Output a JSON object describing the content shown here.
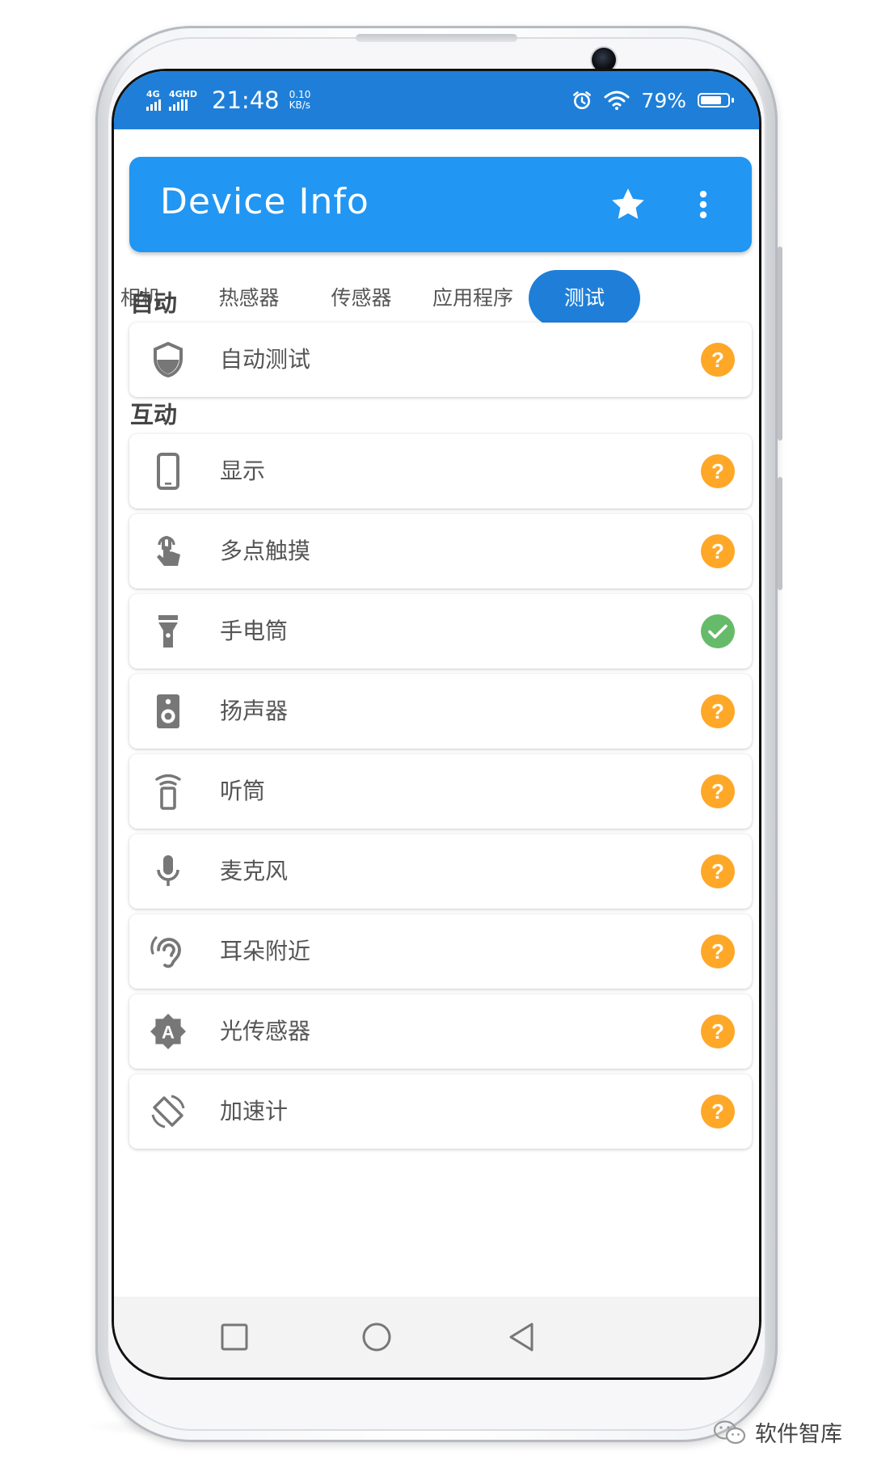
{
  "status_bar": {
    "sim1_label": "4G",
    "sim2_label": "4GHD",
    "time": "21:48",
    "speed_value": "0.10",
    "speed_unit": "KB/s",
    "battery_percent": "79%",
    "battery_level": 0.79,
    "icons": [
      "alarm-icon",
      "wifi-icon",
      "battery-icon"
    ]
  },
  "app_bar": {
    "title": "Device Info",
    "actions": [
      "star-icon",
      "more-vert-icon"
    ]
  },
  "tabs": [
    {
      "label": "相机",
      "active": false
    },
    {
      "label": "热感器",
      "active": false
    },
    {
      "label": "传感器",
      "active": false
    },
    {
      "label": "应用程序",
      "active": false
    },
    {
      "label": "测试",
      "active": true
    }
  ],
  "sections": [
    {
      "title": "自动",
      "items": [
        {
          "label": "自动测试",
          "icon": "shield-icon",
          "status": "unknown"
        }
      ]
    },
    {
      "title": "互动",
      "items": [
        {
          "label": "显示",
          "icon": "phone-icon",
          "status": "unknown"
        },
        {
          "label": "多点触摸",
          "icon": "touch-icon",
          "status": "unknown"
        },
        {
          "label": "手电筒",
          "icon": "flashlight-icon",
          "status": "passed"
        },
        {
          "label": "扬声器",
          "icon": "speaker-icon",
          "status": "unknown"
        },
        {
          "label": "听筒",
          "icon": "earpiece-icon",
          "status": "unknown"
        },
        {
          "label": "麦克风",
          "icon": "microphone-icon",
          "status": "unknown"
        },
        {
          "label": "耳朵附近",
          "icon": "hearing-icon",
          "status": "unknown"
        },
        {
          "label": "光传感器",
          "icon": "brightness-auto-icon",
          "status": "unknown"
        },
        {
          "label": "加速计",
          "icon": "screen-rotation-icon",
          "status": "unknown"
        }
      ]
    }
  ],
  "nav_bar": [
    "recents-square-icon",
    "home-circle-icon",
    "back-triangle-icon"
  ],
  "colors": {
    "status_bar": "#1f7fd8",
    "app_bar": "#2196f3",
    "unknown": "#ffa726",
    "passed": "#66bb6a"
  },
  "watermark": {
    "text": "软件智库",
    "icon": "wechat-icon"
  }
}
